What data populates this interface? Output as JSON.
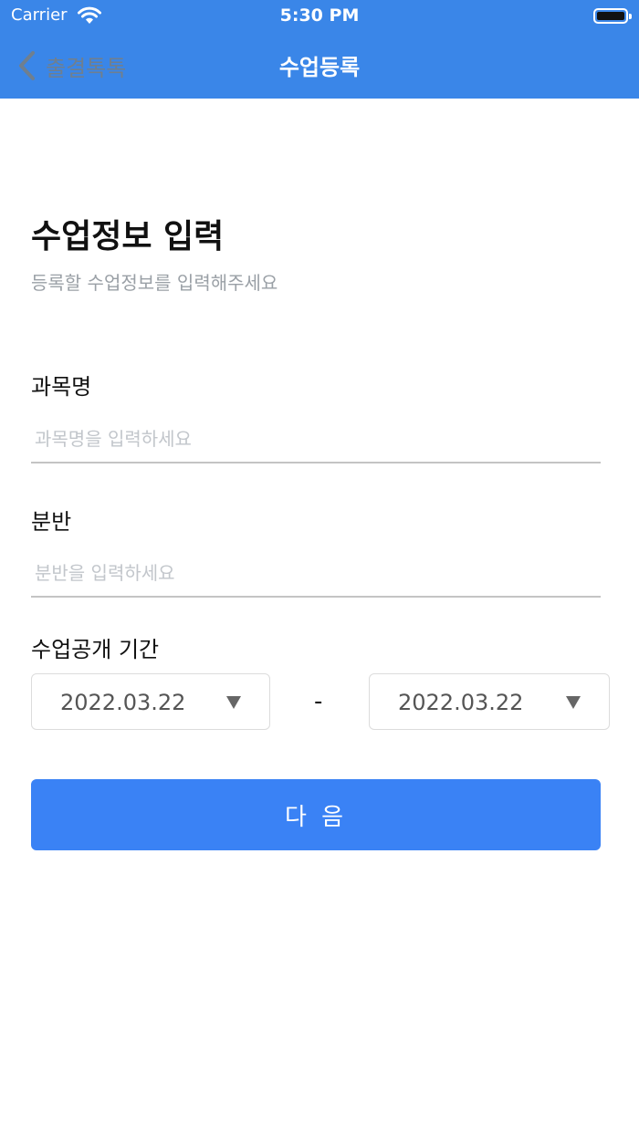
{
  "status_bar": {
    "carrier": "Carrier",
    "time": "5:30 PM"
  },
  "nav": {
    "back_label": "출결톡톡",
    "title": "수업등록"
  },
  "header": {
    "title": "수업정보 입력",
    "subtitle": "등록할 수업정보를 입력해주세요"
  },
  "form": {
    "subject": {
      "label": "과목명",
      "placeholder": "과목명을 입력하세요",
      "value": ""
    },
    "section": {
      "label": "분반",
      "placeholder": "분반을 입력하세요",
      "value": ""
    },
    "period": {
      "label": "수업공개 기간",
      "start": "2022.03.22",
      "separator": "-",
      "end": "2022.03.22"
    }
  },
  "next_button": {
    "label": "다 음"
  },
  "colors": {
    "header_bg": "#3a86e8",
    "button_bg": "#3a82f5",
    "back_label": "#6f7f8f"
  },
  "icons": {
    "back": "chevron-left-icon",
    "dropdown": "triangle-down-icon",
    "wifi": "wifi-icon",
    "battery": "battery-icon"
  }
}
